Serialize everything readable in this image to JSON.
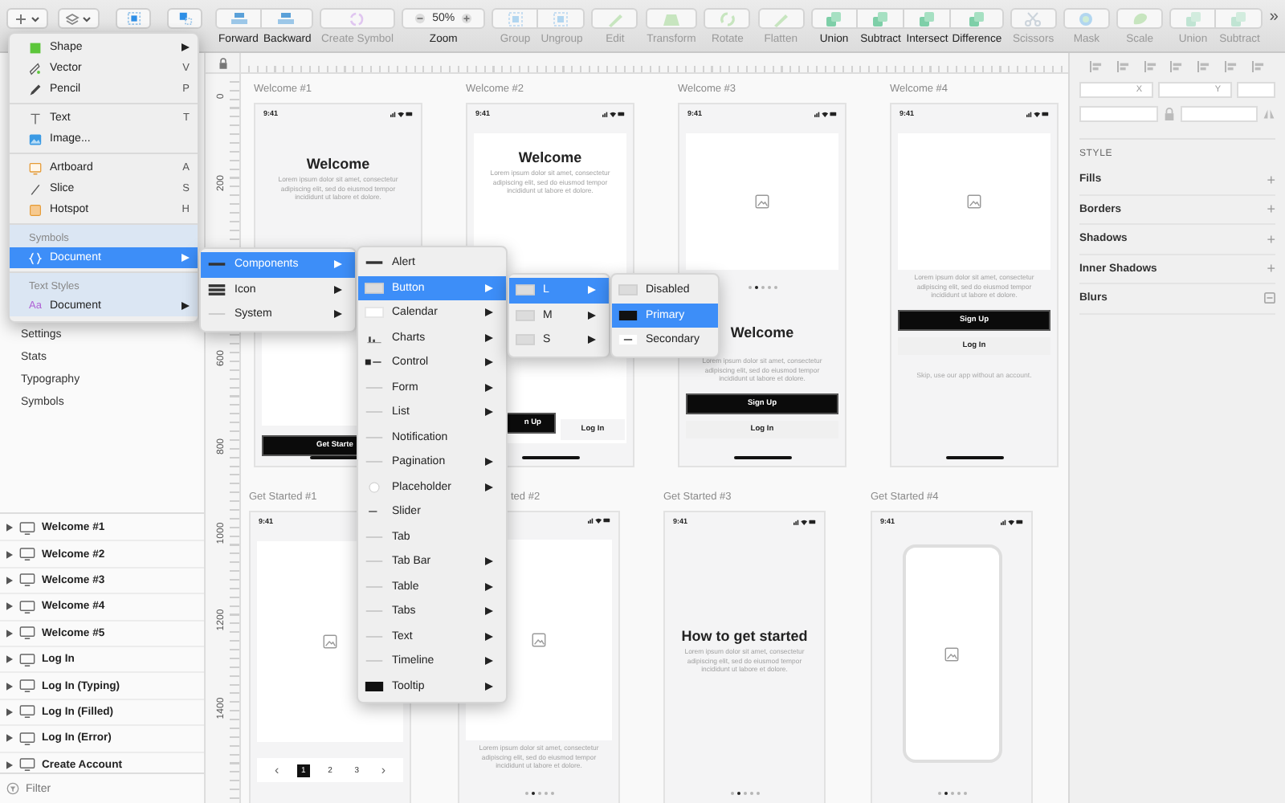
{
  "toolbar": {
    "groups": [
      {
        "items": [
          {
            "kind": "button",
            "label": "Forward",
            "disabled": false
          },
          {
            "kind": "button",
            "label": "Backward",
            "disabled": false
          }
        ]
      },
      {
        "items": [
          {
            "kind": "button",
            "label": "Create Symbol",
            "disabled": true
          }
        ]
      },
      {
        "items": [
          {
            "kind": "zoom",
            "label": "Zoom",
            "value": "50%"
          }
        ]
      },
      {
        "items": [
          {
            "kind": "button",
            "label": "Group",
            "disabled": true
          },
          {
            "kind": "button",
            "label": "Ungroup",
            "disabled": true
          }
        ]
      },
      {
        "items": [
          {
            "kind": "button",
            "label": "Edit",
            "disabled": true
          }
        ]
      },
      {
        "items": [
          {
            "kind": "button",
            "label": "Transform",
            "disabled": true
          }
        ]
      },
      {
        "items": [
          {
            "kind": "button",
            "label": "Rotate",
            "disabled": true
          }
        ]
      },
      {
        "items": [
          {
            "kind": "button",
            "label": "Flatten",
            "disabled": true
          }
        ]
      },
      {
        "items": [
          {
            "kind": "button",
            "label": "Union",
            "disabled": false
          },
          {
            "kind": "button",
            "label": "Subtract",
            "disabled": false
          },
          {
            "kind": "button",
            "label": "Intersect",
            "disabled": false
          },
          {
            "kind": "button",
            "label": "Difference",
            "disabled": false
          }
        ]
      },
      {
        "items": [
          {
            "kind": "button",
            "label": "Scissors",
            "disabled": true
          }
        ]
      },
      {
        "items": [
          {
            "kind": "button",
            "label": "Mask",
            "disabled": true
          }
        ]
      },
      {
        "items": [
          {
            "kind": "button",
            "label": "Scale",
            "disabled": true
          }
        ]
      },
      {
        "items": [
          {
            "kind": "button",
            "label": "Union",
            "disabled": true
          },
          {
            "kind": "button",
            "label": "Subtract",
            "disabled": true
          }
        ]
      }
    ],
    "overflow": "»"
  },
  "pages": [
    {
      "label": "Settings"
    },
    {
      "label": "Stats"
    },
    {
      "label": "Typography"
    },
    {
      "label": "Symbols"
    }
  ],
  "layers": [
    {
      "label": "Welcome #1"
    },
    {
      "label": "Welcome #2"
    },
    {
      "label": "Welcome #3"
    },
    {
      "label": "Welcome #4"
    },
    {
      "label": "Welcome #5"
    },
    {
      "label": "Log In"
    },
    {
      "label": "Log In (Typing)"
    },
    {
      "label": "Log In (Filled)"
    },
    {
      "label": "Log In (Error)"
    },
    {
      "label": "Create Account"
    }
  ],
  "filter": {
    "placeholder": "Filter"
  },
  "vertical_ruler": {
    "labels": [
      "0",
      "200",
      "600",
      "800",
      "1000",
      "1200",
      "1400"
    ]
  },
  "artboards": [
    {
      "title": "Welcome #1",
      "time": "9:41",
      "blocks": [
        {
          "kind": "heading",
          "text": "Welcome"
        },
        {
          "kind": "paragraph",
          "text": "Lorem ipsum dolor sit amet, consectetur adipiscing elit, sed do eiusmod tempor incididunt ut labore et dolore."
        },
        {
          "kind": "panel"
        },
        {
          "kind": "primary-button",
          "text": "Get Starte"
        },
        {
          "kind": "home-bar"
        }
      ]
    },
    {
      "title": "Welcome #2",
      "time": "9:41",
      "blocks": [
        {
          "kind": "card",
          "blocks": [
            {
              "kind": "heading",
              "text": "Welcome"
            },
            {
              "kind": "paragraph",
              "text": "Lorem ipsum dolor sit amet, consectetur adipiscing elit, sed do eiusmod tempor incididunt ut labore et dolore."
            },
            {
              "kind": "button-row",
              "buttons": [
                {
                  "kind": "primary-button",
                  "text": "n Up"
                },
                {
                  "kind": "secondary-button",
                  "text": "Log In"
                }
              ]
            }
          ]
        },
        {
          "kind": "home-bar"
        }
      ]
    },
    {
      "title": "Welcome #3",
      "time": "9:41",
      "blocks": [
        {
          "kind": "image"
        },
        {
          "kind": "dots",
          "dots": [
            {
              "selected": false
            },
            {
              "selected": true
            },
            {
              "selected": false
            },
            {
              "selected": false
            },
            {
              "selected": false
            }
          ]
        },
        {
          "kind": "heading",
          "text": "Welcome"
        },
        {
          "kind": "paragraph",
          "text": "Lorem ipsum dolor sit amet, consectetur adipiscing elit, sed do eiusmod tempor incididunt ut labore et dolore."
        },
        {
          "kind": "primary-button",
          "text": "Sign Up"
        },
        {
          "kind": "secondary-button",
          "text": "Log In"
        },
        {
          "kind": "home-bar"
        }
      ]
    },
    {
      "title": "Welcome #4",
      "time": "9:41",
      "blocks": [
        {
          "kind": "image"
        },
        {
          "kind": "paragraph",
          "text": "Lorem ipsum dolor sit amet, consectetur adipiscing elit, sed do eiusmod tempor incididunt ut labore et dolore."
        },
        {
          "kind": "primary-button",
          "text": "Sign Up"
        },
        {
          "kind": "secondary-button",
          "text": "Log In"
        },
        {
          "kind": "note",
          "text": "Skip, use our app without an account."
        },
        {
          "kind": "home-bar"
        }
      ]
    },
    {
      "title": "Get Started #1",
      "time": "9:41",
      "blocks": [
        {
          "kind": "image"
        },
        {
          "kind": "pagination",
          "prev": "‹",
          "next": "›",
          "pages": [
            {
              "label": "1",
              "selected": true
            },
            {
              "label": "2",
              "selected": false
            },
            {
              "label": "3",
              "selected": false
            }
          ]
        }
      ]
    },
    {
      "title": "ted #2",
      "blocks": [
        {
          "kind": "image"
        },
        {
          "kind": "paragraph",
          "text": "Lorem ipsum dolor sit amet, consectetur adipiscing elit, sed do eiusmod tempor incididunt ut labore et dolore."
        },
        {
          "kind": "dots",
          "dots": [
            {
              "selected": false
            },
            {
              "selected": true
            },
            {
              "selected": false
            },
            {
              "selected": false
            },
            {
              "selected": false
            }
          ]
        }
      ]
    },
    {
      "title": "Get Started #3",
      "time": "9:41",
      "blocks": [
        {
          "kind": "heading",
          "text": "How to get started"
        },
        {
          "kind": "paragraph",
          "text": "Lorem ipsum dolor sit amet, consectetur adipiscing elit, sed do eiusmod tempor incididunt ut labore et dolore."
        },
        {
          "kind": "dots",
          "dots": [
            {
              "selected": false
            },
            {
              "selected": true
            },
            {
              "selected": false
            },
            {
              "selected": false
            },
            {
              "selected": false
            }
          ]
        }
      ]
    },
    {
      "title": "Get Started #4",
      "time": "9:41",
      "blocks": [
        {
          "kind": "phone"
        },
        {
          "kind": "dots",
          "dots": [
            {
              "selected": false
            },
            {
              "selected": true
            },
            {
              "selected": false
            },
            {
              "selected": false
            },
            {
              "selected": false
            }
          ]
        }
      ]
    }
  ],
  "inspector": {
    "position_fields": [
      {
        "label": "X"
      },
      {
        "label": "Y"
      }
    ],
    "style_title": "STYLE",
    "style_rows": [
      {
        "label": "Fills",
        "kind": "add",
        "action": "+"
      },
      {
        "label": "Borders",
        "kind": "add",
        "action": "+"
      },
      {
        "label": "Shadows",
        "kind": "add",
        "action": "+"
      },
      {
        "label": "Inner Shadows",
        "kind": "add",
        "action": "+"
      },
      {
        "label": "Blurs",
        "kind": "settings"
      }
    ]
  },
  "insert_menu": {
    "sections": [
      {
        "items": [
          {
            "label": "Shape",
            "submenu": true,
            "selected": false
          },
          {
            "label": "Vector",
            "shortcut": "V",
            "submenu": false,
            "selected": false
          },
          {
            "label": "Pencil",
            "shortcut": "P",
            "submenu": false,
            "selected": false
          }
        ]
      },
      {
        "items": [
          {
            "label": "Text",
            "shortcut": "T",
            "submenu": false,
            "selected": false
          },
          {
            "label": "Image...",
            "submenu": false,
            "selected": false
          }
        ]
      },
      {
        "items": [
          {
            "label": "Artboard",
            "shortcut": "A",
            "submenu": false,
            "selected": false
          },
          {
            "label": "Slice",
            "shortcut": "S",
            "submenu": false,
            "selected": false
          },
          {
            "label": "Hotspot",
            "shortcut": "H",
            "submenu": false,
            "selected": false
          }
        ]
      },
      {
        "header": "Symbols",
        "items": [
          {
            "label": "Document",
            "submenu": true,
            "selected": true
          }
        ]
      },
      {
        "header": "Text Styles",
        "items": [
          {
            "label": "Document",
            "icon_text": "Aa",
            "submenu": true,
            "selected": false
          }
        ]
      }
    ]
  },
  "symbol_menus": [
    {
      "items": [
        {
          "label": "Components",
          "submenu": true,
          "selected": true
        },
        {
          "label": "Icon",
          "submenu": true,
          "selected": false
        },
        {
          "label": "System",
          "submenu": true,
          "selected": false
        }
      ]
    },
    {
      "items": [
        {
          "label": "Alert",
          "submenu": false,
          "selected": false
        },
        {
          "label": "Button",
          "submenu": true,
          "selected": true
        },
        {
          "label": "Calendar",
          "submenu": true,
          "selected": false
        },
        {
          "label": "Charts",
          "submenu": true,
          "selected": false
        },
        {
          "label": "Control",
          "submenu": true,
          "selected": false
        },
        {
          "label": "Form",
          "submenu": true,
          "selected": false
        },
        {
          "label": "List",
          "submenu": true,
          "selected": false
        },
        {
          "label": "Notification",
          "submenu": false,
          "selected": false
        },
        {
          "label": "Pagination",
          "submenu": true,
          "selected": false
        },
        {
          "label": "Placeholder",
          "submenu": true,
          "selected": false
        },
        {
          "label": "Slider",
          "submenu": false,
          "selected": false
        },
        {
          "label": "Tab",
          "submenu": false,
          "selected": false
        },
        {
          "label": "Tab Bar",
          "submenu": true,
          "selected": false
        },
        {
          "label": "Table",
          "submenu": true,
          "selected": false
        },
        {
          "label": "Tabs",
          "submenu": true,
          "selected": false
        },
        {
          "label": "Text",
          "submenu": true,
          "selected": false
        },
        {
          "label": "Timeline",
          "submenu": true,
          "selected": false
        },
        {
          "label": "Tooltip",
          "submenu": true,
          "selected": false
        }
      ]
    },
    {
      "items": [
        {
          "label": "L",
          "submenu": true,
          "selected": true
        },
        {
          "label": "M",
          "submenu": true,
          "selected": false
        },
        {
          "label": "S",
          "submenu": true,
          "selected": false
        }
      ]
    },
    {
      "items": [
        {
          "label": "Disabled",
          "submenu": false,
          "selected": false
        },
        {
          "label": "Primary",
          "submenu": false,
          "selected": true
        },
        {
          "label": "Secondary",
          "submenu": false,
          "selected": false
        }
      ]
    }
  ]
}
